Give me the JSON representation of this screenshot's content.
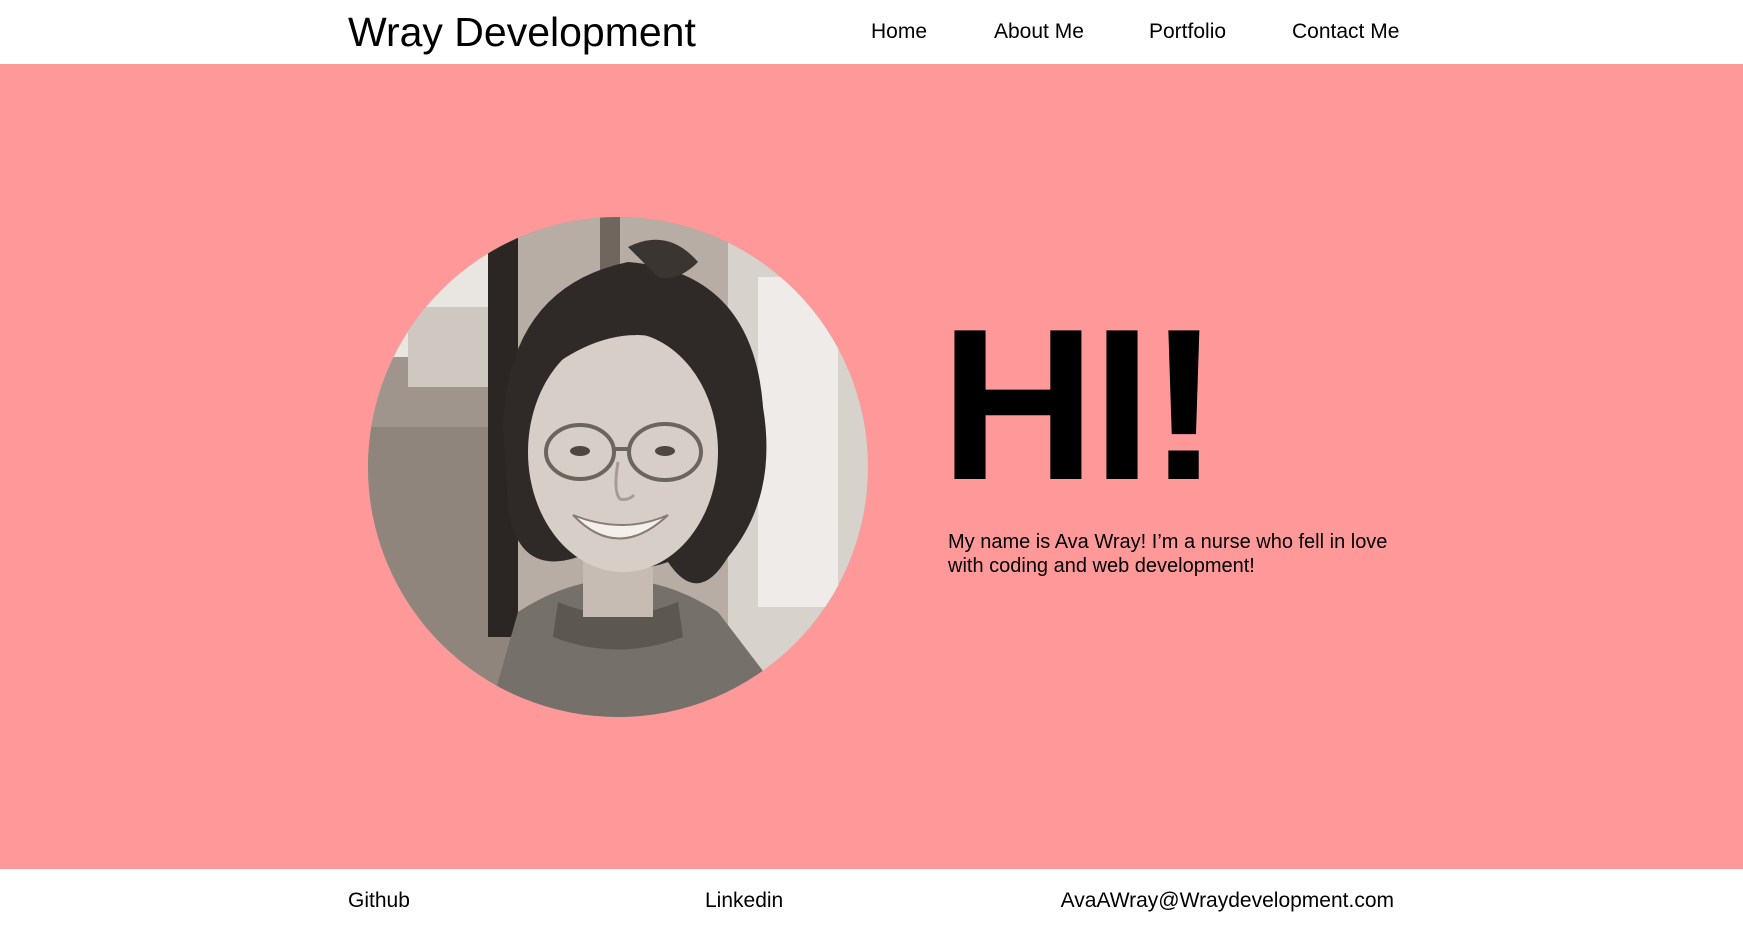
{
  "header": {
    "brand": "Wray Development",
    "nav": {
      "home": "Home",
      "about": "About Me",
      "portfolio": "Portfolio",
      "contact": "Contact Me"
    }
  },
  "hero": {
    "greeting": "HI!",
    "intro": "My name is Ava Wray! I’m a nurse who fell in love with coding and web development!",
    "photo_icon": "profile-photo",
    "background_color": "#ff9999"
  },
  "footer": {
    "github": "Github",
    "linkedin": "Linkedin",
    "email": "AvaAWray@Wraydevelopment.com"
  }
}
